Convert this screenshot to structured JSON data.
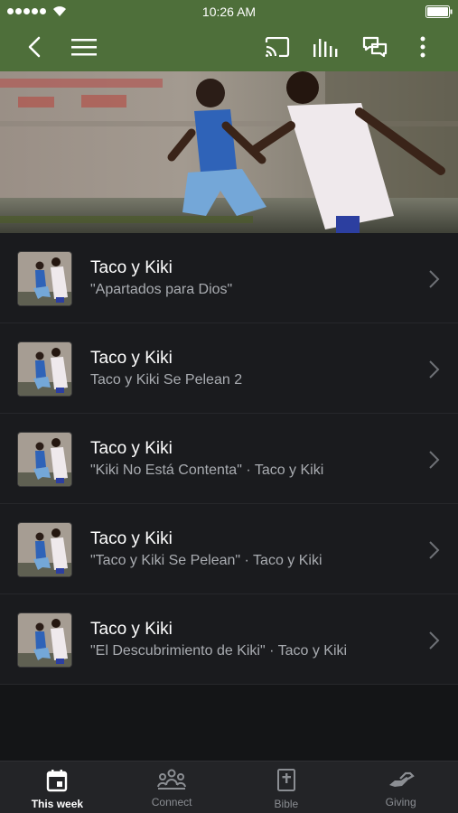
{
  "status_bar": {
    "time": "10:26 AM"
  },
  "list": {
    "items": [
      {
        "title": "Taco y Kiki",
        "subtitle": "\"Apartados para Dios\""
      },
      {
        "title": "Taco y Kiki",
        "subtitle": "Taco y Kiki Se Pelean 2"
      },
      {
        "title": "Taco y Kiki",
        "subtitle": "\"Kiki No Está Contenta\" · Taco y Kiki"
      },
      {
        "title": "Taco y Kiki",
        "subtitle": "\"Taco y Kiki Se Pelean\" · Taco y Kiki"
      },
      {
        "title": "Taco y Kiki",
        "subtitle": "\"El Descubrimiento de Kiki\" · Taco y Kiki"
      }
    ]
  },
  "tab_bar": {
    "tabs": [
      {
        "label": "This week",
        "icon": "calendar-icon",
        "active": true
      },
      {
        "label": "Connect",
        "icon": "people-icon",
        "active": false
      },
      {
        "label": "Bible",
        "icon": "bible-icon",
        "active": false
      },
      {
        "label": "Giving",
        "icon": "giving-hand-icon",
        "active": false
      }
    ]
  },
  "colors": {
    "header": "#4e6f3a",
    "list_background": "#1a1b1e",
    "tab_bar": "#232427"
  }
}
